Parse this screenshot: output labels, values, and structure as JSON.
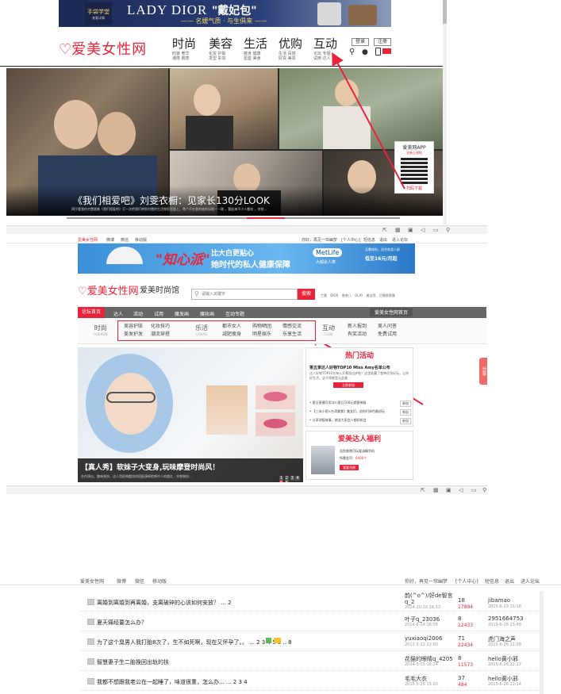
{
  "top_banner": {
    "left_badge": "手袋学堂",
    "left_badge_small": "查看详情",
    "title": "LADY DIOR",
    "title_cn": "\"戴妃包\"",
    "subtitle": "—— 名媛气质 · 与生俱来 ——"
  },
  "site1": {
    "logo": "爱美女性网",
    "nav": [
      {
        "label": "时尚",
        "sub1": "时装 奢华",
        "sub2": "潮搭 腕表"
      },
      {
        "label": "美容",
        "sub1": "化妆 护肤",
        "sub2": "发型 彩妆"
      },
      {
        "label": "生活",
        "sub1": "瘦身 健康",
        "sub2": "星座 美食"
      },
      {
        "label": "优购",
        "sub1": "生活 百搭",
        "sub2": "好货 美妆"
      },
      {
        "label": "互动",
        "sub1": "论坛 专题",
        "sub2": "试用 达人"
      }
    ],
    "login": "登录",
    "register": "注册",
    "hero_caption": "《我们相爱吧》刘雯衣橱：见家长130分LOOK",
    "hero_desc": "两仔看我的刘雯随着《我们相爱吧》又一次把我们带到刘雯的生活穿搭里面上，两个不在意的她的风格——刚 ，看起来不少人都欢 ，你觉...",
    "app_label": "爱美网APP",
    "app_sub": "全新上线啦",
    "app_download": "扫码下载"
  },
  "toolbar_icons": [
    "share-icon",
    "grid-icon",
    "lock-icon",
    "sound-icon",
    "chat-icon",
    "search-icon"
  ],
  "site2": {
    "topbar": {
      "links": [
        "爱美女性网",
        "微博",
        "微信",
        "移动版"
      ],
      "right": [
        "你好，再见一帘幽梦",
        "[个人中心]",
        "短信息",
        "退出",
        "进入论坛"
      ]
    },
    "banner": {
      "title": "\"知心派\"",
      "sub1": "比大白更贴心",
      "sub2": "她时代的私人健康保障",
      "brand": "MetLife",
      "brand_sub": "大都会人寿",
      "right_text": "无需体检，适合各类人群",
      "price": "低至16元/月起"
    },
    "logo": "爱美女性网",
    "section_title": "爱美时尚馆",
    "search_placeholder": "请输入关键字",
    "search_button": "搜索",
    "hot_tags": [
      "兰蔻",
      "DIOR",
      "香奈儿",
      "OLAY",
      "美宝莲",
      "巴黎欧莱雅"
    ],
    "mainnav": [
      "论坛首页",
      "达人",
      "活动",
      "试用",
      "魔发画",
      "魔妆画",
      "互动专题"
    ],
    "mainnav_right": "爱美女性网首页",
    "megamenu": {
      "fashion_title": "时尚",
      "fashion_en": "FASHION",
      "fashion_items": [
        "美容护肤",
        "化妆技巧",
        "美发护发",
        "潮流穿搭"
      ],
      "life_title": "乐活",
      "life_en": "LOHAS",
      "life_items": [
        "都市女人",
        "购物晒团",
        "情感交流",
        "减肥瘦身",
        "明星娱乐",
        "乐享生活"
      ],
      "club_title": "互动",
      "club_en": "CLUB",
      "club_items": [
        "新人报到",
        "美人问答",
        "有奖活动",
        "免费试用"
      ]
    },
    "slider_caption": "【真人秀】软妹子大变身,玩味摩登时尚风！",
    "slider_desc": "合作演出，趣味装扮，达人用经典酷炫的搭配演绎脸颊中人的超红，并做装扮...",
    "slider_pages": [
      "1",
      "2",
      "3",
      "4",
      "5",
      "6"
    ],
    "hot": {
      "title": "热门活动",
      "headline": "第五季达人好物TOP10 Miss Amy名单公布",
      "desc": "达人好物TOP10名单公开票投出炉啦！这里收藏了各种优秀好玩，让你好生活，这不停都是无此美...",
      "join": "立即参加",
      "items": [
        {
          "text": "夏日直播可用冰川夏日100元提瘦神器",
          "btn": "参加"
        },
        {
          "text": "【三米小雨×台湾美食】美女们，追你们体色最初玩",
          "btn": "参加"
        },
        {
          "text": "分享测报故事，就送大家会人都好机会",
          "btn": "参加"
        }
      ]
    },
    "welfare": {
      "title": "爱美达人福利",
      "item": "告别香港可玩爱油精华机",
      "points_label": "所需金币：",
      "points": "6400个",
      "btn": "我要兑换"
    },
    "side_tab": "分享"
  },
  "site3": {
    "topbar": {
      "links": [
        "爱美女性网",
        "微博",
        "微信",
        "移动版"
      ],
      "right": [
        "你好，再见一帘幽梦",
        "[个人中心]",
        "短信息",
        "退出",
        "进入论坛"
      ]
    },
    "threads": [
      {
        "title": "离婚到离婚到再离婚，支离破碎的心该如何安放？ ... 2",
        "author": "韵(^o^)/好de智言q_2",
        "date": "2014-10-10 16:13",
        "replies": "18",
        "views": "17894",
        "last_user": "jibamao",
        "last_date": "2015-6-29 15:16"
      },
      {
        "title": "夏天痛经要怎么办？",
        "author": "叶子q_23036",
        "date": "2014-6-14 16:05",
        "replies": "8",
        "views": "12433",
        "last_user": "2951664753",
        "last_date": "2015-6-28 23:48"
      },
      {
        "title": "为了这个臭男人我打胎8次了，生不如死啊，现在又怀孕了。。 ... 2 3 4 5 6 .. 8",
        "author": "yuxiaoqi2006",
        "date": "2012-3-12 22:00",
        "replies": "71",
        "views": "22434",
        "last_user": "虎门海之声",
        "last_date": "2015-6-26 11:08"
      },
      {
        "title": "智慧妻子生二胎挽回出轨的扶",
        "author": "花猫的眼睛q_4205",
        "date": "2014-5-15 14:24",
        "replies": "8",
        "views": "11573",
        "last_user": "hello黄小邪",
        "last_date": "2015-6-26 22:17"
      },
      {
        "title": "我都不想跟我老公在一起睡了，味道很重，怎么办... ... 2 3 4",
        "author": "毛毛大衣",
        "date": "2015-5-28 15:20",
        "replies": "37",
        "views": "484",
        "last_user": "hello黄小邪",
        "last_date": "2015-6-26 22:14"
      }
    ]
  },
  "colors": {
    "brand_red": "#e8243a",
    "nav_gray": "#666666",
    "arrow": "#e8243a"
  }
}
